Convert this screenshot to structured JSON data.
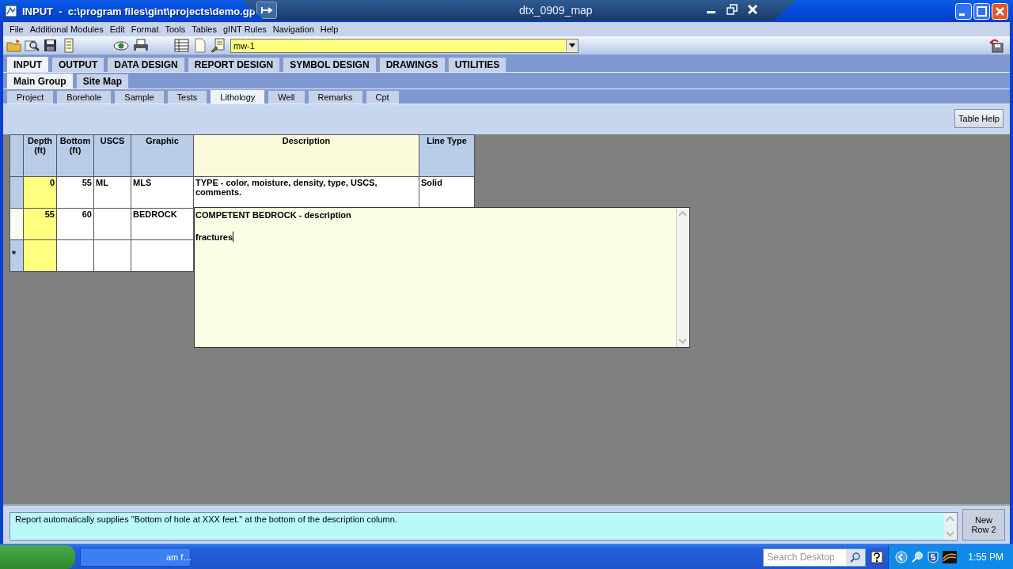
{
  "window": {
    "title": "INPUT  -  c:\\program files\\gint\\projects\\demo.gp"
  },
  "remote_bar": {
    "title": "dtx_0909_map"
  },
  "menu": [
    "File",
    "Additional Modules",
    "Edit",
    "Format",
    "Tools",
    "Tables",
    "gINT Rules",
    "Navigation",
    "Help"
  ],
  "toolbar": {
    "selector": {
      "value": "mw-1"
    }
  },
  "main_tabs": [
    {
      "label": "INPUT",
      "selected": true
    },
    {
      "label": "OUTPUT",
      "selected": false
    },
    {
      "label": "DATA DESIGN",
      "selected": false
    },
    {
      "label": "REPORT DESIGN",
      "selected": false
    },
    {
      "label": "SYMBOL DESIGN",
      "selected": false
    },
    {
      "label": "DRAWINGS",
      "selected": false
    },
    {
      "label": "UTILITIES",
      "selected": false
    }
  ],
  "group_tabs": [
    {
      "label": "Main Group",
      "selected": true
    },
    {
      "label": "Site Map",
      "selected": false
    }
  ],
  "table_tabs": [
    {
      "label": "Project",
      "selected": false
    },
    {
      "label": "Borehole",
      "selected": false
    },
    {
      "label": "Sample",
      "selected": false
    },
    {
      "label": "Tests",
      "selected": false
    },
    {
      "label": "Lithology",
      "selected": true
    },
    {
      "label": "Well",
      "selected": false
    },
    {
      "label": "Remarks",
      "selected": false
    },
    {
      "label": "Cpt",
      "selected": false
    }
  ],
  "table_help_button": "Table Help",
  "table": {
    "columns": [
      {
        "label": "Depth (ft)",
        "kind": "key"
      },
      {
        "label": "Bottom (ft)",
        "kind": "plain"
      },
      {
        "label": "USCS",
        "kind": "plain"
      },
      {
        "label": "Graphic",
        "kind": "plain"
      },
      {
        "label": "Description",
        "kind": "memo"
      },
      {
        "label": "Line Type",
        "kind": "plain"
      }
    ],
    "rows": [
      {
        "selected": false,
        "cells": [
          "0",
          "55",
          "ML",
          "MLS",
          "TYPE - color, moisture, density, type, USCS, comments.",
          "Solid"
        ]
      },
      {
        "selected": true,
        "cells": [
          "55",
          "60",
          null,
          "BEDROCK"
        ]
      },
      {
        "selected": false,
        "marker": "*"
      }
    ]
  },
  "memo_editor": {
    "text": "COMPETENT BEDROCK - description\n\nfractures"
  },
  "help_panel": {
    "text": "Report automatically supplies \"Bottom of hole at XXX feet.\" at the bottom of the description column.",
    "new_row_button": "New Row 2"
  },
  "taskbar": {
    "tasks": [
      "am f…"
    ],
    "search": {
      "placeholder": "Search Desktop"
    },
    "clock": "1:55 PM"
  }
}
